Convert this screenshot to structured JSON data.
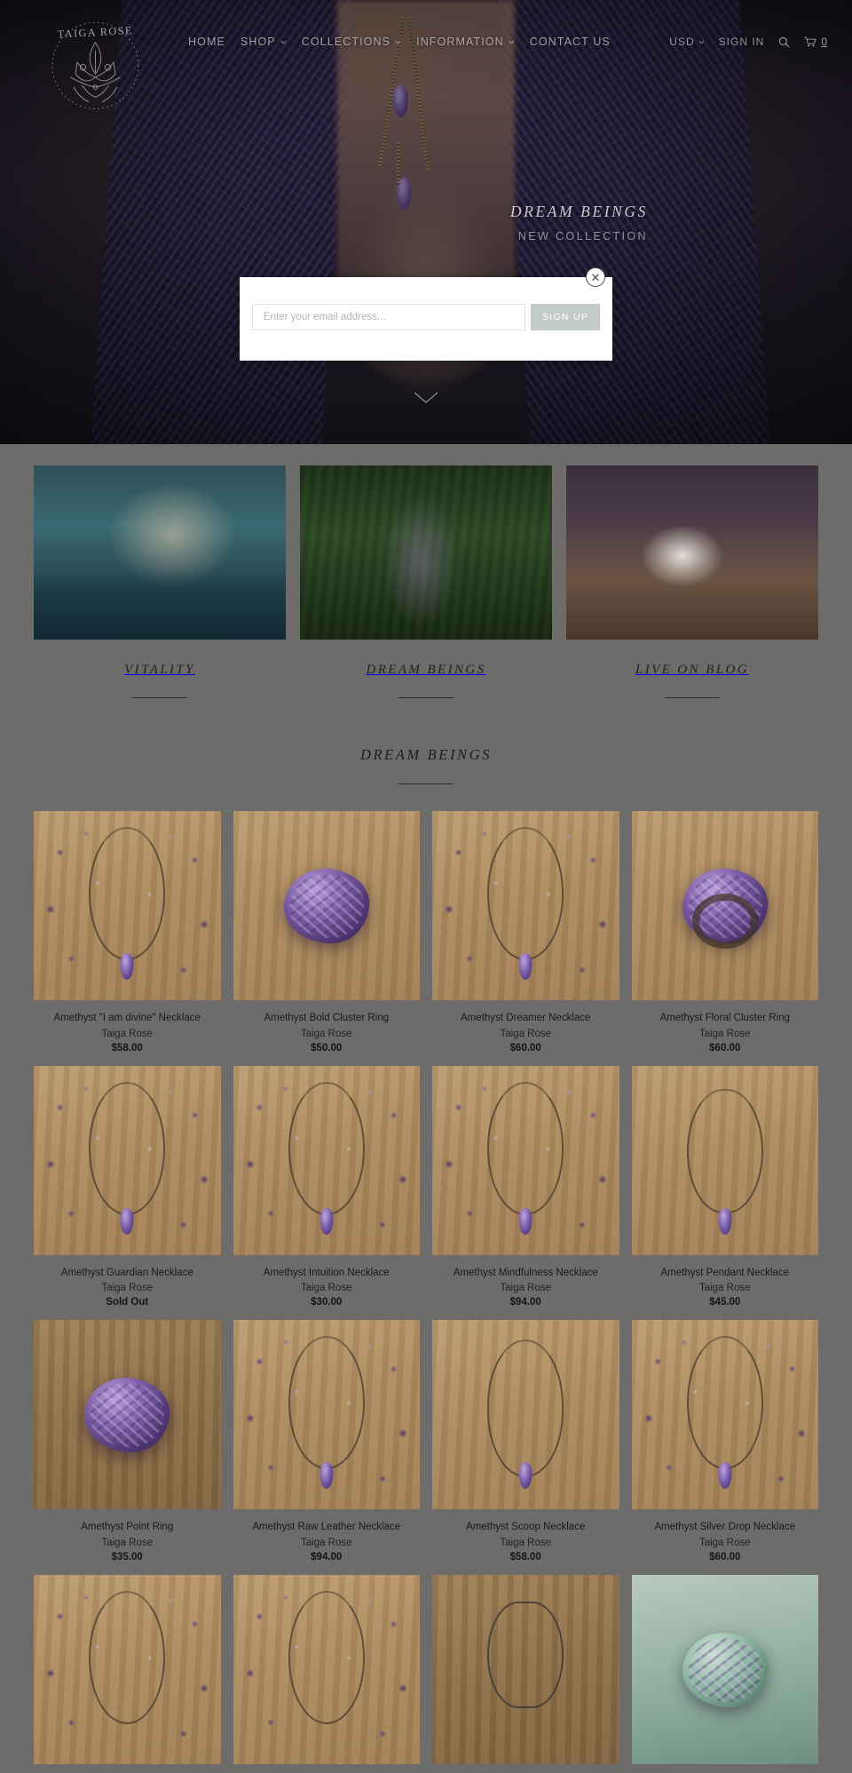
{
  "brand": {
    "name": "TAIGA ROSE",
    "logo_icon": "mandala-lotus-logo"
  },
  "header": {
    "nav": [
      {
        "label": "HOME",
        "has_caret": false
      },
      {
        "label": "SHOP",
        "has_caret": true
      },
      {
        "label": "COLLECTIONS",
        "has_caret": true
      },
      {
        "label": "INFORMATION",
        "has_caret": true
      },
      {
        "label": "CONTACT US",
        "has_caret": false
      }
    ],
    "currency": "USD",
    "sign_in": "SIGN IN",
    "search_icon": "search-icon",
    "cart_icon": "cart-icon",
    "cart_count": "0"
  },
  "hero": {
    "title": "DREAM BEINGS",
    "subtitle": "NEW COLLECTION",
    "scroll_icon": "chevron-down-icon"
  },
  "popup": {
    "email_placeholder": "Enter your email address...",
    "email_value": "",
    "submit_label": "SIGN UP",
    "close_icon": "close-icon"
  },
  "promos": [
    {
      "label": "VITALITY",
      "image": "woman-with-lotus-flower-in-water"
    },
    {
      "label": "DREAM BEINGS",
      "image": "woman-in-forest-arms-open"
    },
    {
      "label": "LIVE ON BLOG",
      "image": "hands-drawing-crystal-illustration"
    }
  ],
  "section": {
    "title": "DREAM BEINGS"
  },
  "products": [
    {
      "title": "Amethyst \"I am divine\" Necklace",
      "vendor": "Taiga Rose",
      "price": "$58.00",
      "style": "scatter-chain"
    },
    {
      "title": "Amethyst Bold Cluster Ring",
      "vendor": "Taiga Rose",
      "price": "$50.00",
      "style": "cluster"
    },
    {
      "title": "Amethyst Dreamer Necklace",
      "vendor": "Taiga Rose",
      "price": "$60.00",
      "style": "scatter-chain"
    },
    {
      "title": "Amethyst Floral Cluster Ring",
      "vendor": "Taiga Rose",
      "price": "$60.00",
      "style": "cluster"
    },
    {
      "title": "Amethyst Guardian Necklace",
      "vendor": "Taiga Rose",
      "price": "Sold Out",
      "style": "scatter-chain"
    },
    {
      "title": "Amethyst Intuition Necklace",
      "vendor": "Taiga Rose",
      "price": "$30.00",
      "style": "scatter-chain"
    },
    {
      "title": "Amethyst Mindfulness Necklace",
      "vendor": "Taiga Rose",
      "price": "$94.00",
      "style": "scatter-chain"
    },
    {
      "title": "Amethyst Pendant Necklace",
      "vendor": "Taiga Rose",
      "price": "$45.00",
      "style": "scatter-chain"
    },
    {
      "title": "Amethyst Point Ring",
      "vendor": "Taiga Rose",
      "price": "$35.00",
      "style": "cluster"
    },
    {
      "title": "Amethyst Raw Leather Necklace",
      "vendor": "Taiga Rose",
      "price": "$94.00",
      "style": "scatter-chain"
    },
    {
      "title": "Amethyst Scoop Necklace",
      "vendor": "Taiga Rose",
      "price": "$58.00",
      "style": "scatter-chain"
    },
    {
      "title": "Amethyst Silver Drop Necklace",
      "vendor": "Taiga Rose",
      "price": "$60.00",
      "style": "scatter-chain"
    },
    {
      "title": "",
      "vendor": "",
      "price": "",
      "style": "scatter-chain"
    },
    {
      "title": "",
      "vendor": "",
      "price": "",
      "style": "scatter-chain"
    },
    {
      "title": "",
      "vendor": "",
      "price": "",
      "style": "cluster"
    },
    {
      "title": "",
      "vendor": "",
      "price": "",
      "style": "cluster"
    }
  ],
  "colors": {
    "page_background": "#6e6c6a",
    "popup_button": "#c2cbc8",
    "text_dark": "#1c1c1c"
  }
}
